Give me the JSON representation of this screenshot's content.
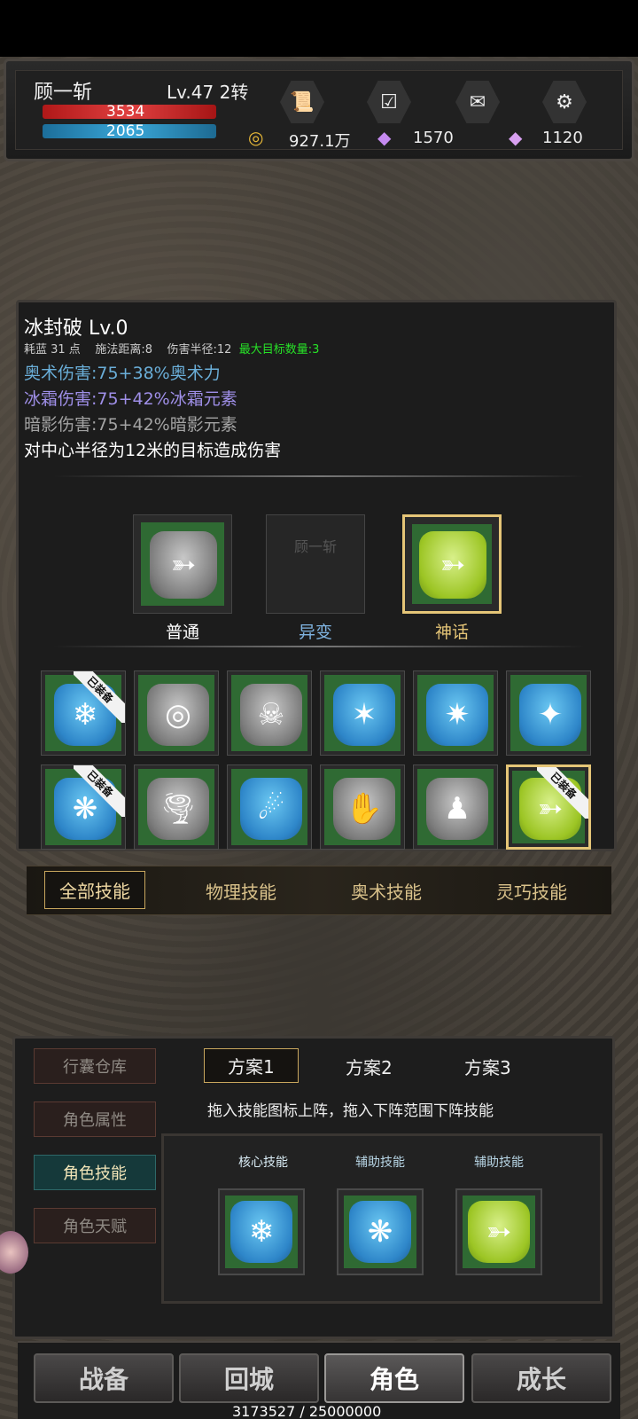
{
  "player": {
    "name": "顾一斩",
    "level": "Lv.47 2转",
    "hp": "3534",
    "mp": "2065",
    "gold": "927.1万",
    "gems": "1570",
    "crystals": "1120"
  },
  "header_icons": [
    "scroll-icon",
    "calendar-check-icon",
    "mail-icon",
    "gear-icon"
  ],
  "skill": {
    "name": "冰封破 Lv.0",
    "stat_cost": "耗蓝 31 点",
    "stat_range": "施法距离:8",
    "stat_radius": "伤害半径:12",
    "stat_targets": "最大目标数量:3",
    "dmg_arcane": "奥术伤害:75+38%奥术力",
    "dmg_frost": "冰霜伤害:75+42%冰霜元素",
    "dmg_shadow": "暗影伤害:75+42%暗影元素",
    "description": "对中心半径为12米的目标造成伤害"
  },
  "rarity": {
    "normal": "普通",
    "mutated": "异变",
    "mythic": "神话",
    "empty_slot_name": "顾一斩"
  },
  "equipped_label": "已装备",
  "category_tabs": [
    "全部技能",
    "物理技能",
    "奥术技能",
    "灵巧技能"
  ],
  "side_tabs": [
    "行囊仓库",
    "角色属性",
    "角色技能",
    "角色天赋"
  ],
  "plans": [
    "方案1",
    "方案2",
    "方案3"
  ],
  "hint": "拖入技能图标上阵，拖入下阵范围下阵技能",
  "loadout_labels": [
    "核心技能",
    "辅助技能",
    "辅助技能"
  ],
  "nav": [
    "战备",
    "回城",
    "角色",
    "成长"
  ],
  "exp": "3173527 / 25000000",
  "colors": {
    "arcane": "#6aaed8",
    "frost": "#9f8fe8",
    "shadow": "#a3a3a3",
    "highlight_green": "#27e227",
    "gold_border": "#e5c577"
  }
}
